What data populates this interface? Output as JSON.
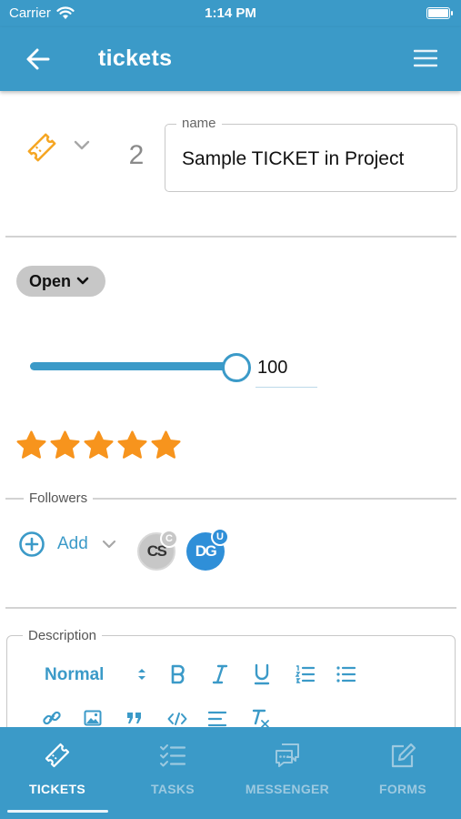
{
  "status_bar": {
    "carrier": "Carrier",
    "time": "1:14 PM"
  },
  "header": {
    "title": "tickets"
  },
  "ticket": {
    "number": "2",
    "name_label": "name",
    "name_value": "Sample TICKET in Project",
    "status": "Open",
    "progress_value": "100",
    "progress_fraction": 1.0,
    "rating": 5,
    "rating_max": 5
  },
  "followers": {
    "label": "Followers",
    "add_label": "Add",
    "people": [
      {
        "initials": "CS",
        "badge": "C"
      },
      {
        "initials": "DG",
        "badge": "U"
      }
    ]
  },
  "description": {
    "label": "Description",
    "format_select": "Normal"
  },
  "tabs": [
    {
      "label": "TICKETS",
      "icon": "ticket-icon",
      "active": true
    },
    {
      "label": "TASKS",
      "icon": "checklist-icon",
      "active": false
    },
    {
      "label": "MESSENGER",
      "icon": "chat-icon",
      "active": false
    },
    {
      "label": "FORMS",
      "icon": "edit-form-icon",
      "active": false
    }
  ],
  "colors": {
    "primary": "#3b9ac8",
    "star": "#f7941d",
    "ticket_icon": "#f5a623",
    "avatar_gray": "#c7c7c7",
    "avatar_blue": "#2f8fd8"
  }
}
